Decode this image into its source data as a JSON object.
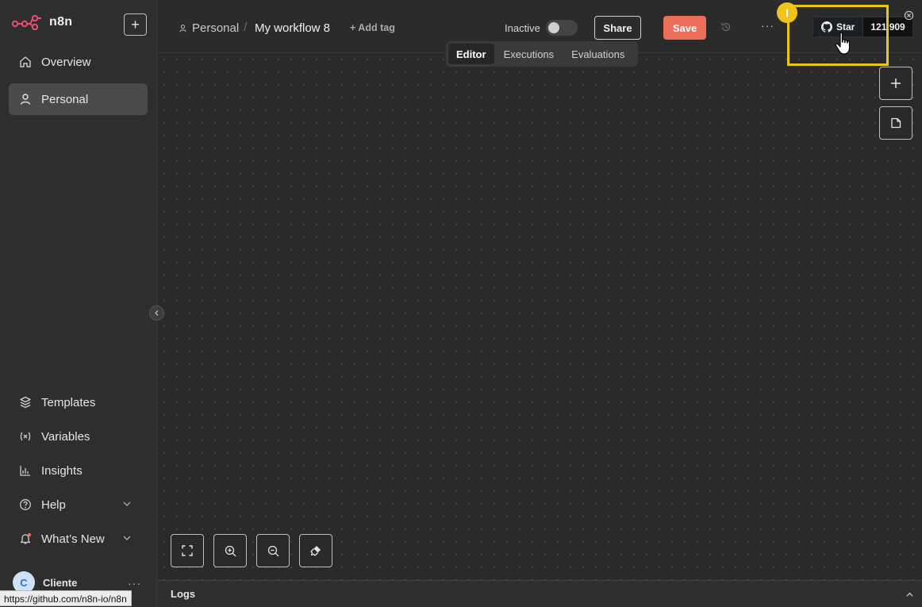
{
  "app": {
    "name": "n8n"
  },
  "sidebar": {
    "new_button": "+",
    "top_items": [
      {
        "label": "Overview",
        "icon": "home-icon"
      },
      {
        "label": "Personal",
        "icon": "user-icon",
        "active": true
      }
    ],
    "bottom_items": [
      {
        "label": "Templates",
        "icon": "box-icon"
      },
      {
        "label": "Variables",
        "icon": "variable-icon"
      },
      {
        "label": "Insights",
        "icon": "chart-icon"
      },
      {
        "label": "Help",
        "icon": "help-icon"
      },
      {
        "label": "What’s New",
        "icon": "bell-icon"
      }
    ],
    "user": {
      "initial": "C",
      "name": "Cliente",
      "more": "···"
    }
  },
  "status_bar": {
    "url": "https://github.com/n8n-io/n8n"
  },
  "header": {
    "breadcrumb_project": "Personal",
    "breadcrumb_sep": "/",
    "workflow_title": "My workflow 8",
    "add_tag": "+ Add tag",
    "active_state": "Inactive",
    "share_label": "Share",
    "save_label": "Save",
    "more": "···",
    "github": {
      "star_label": "Star",
      "count": "121,909"
    }
  },
  "annotation": {
    "marker": "I",
    "highlight_color": "#e8c81e"
  },
  "tabs": [
    {
      "label": "Editor",
      "active": true
    },
    {
      "label": "Executions"
    },
    {
      "label": "Evaluations"
    }
  ],
  "canvas_tools": {
    "add": "+"
  },
  "logs": {
    "label": "Logs"
  },
  "colors": {
    "save": "#ea6e5a",
    "logo": "#ea4b71",
    "background": "#2a2a2a"
  }
}
